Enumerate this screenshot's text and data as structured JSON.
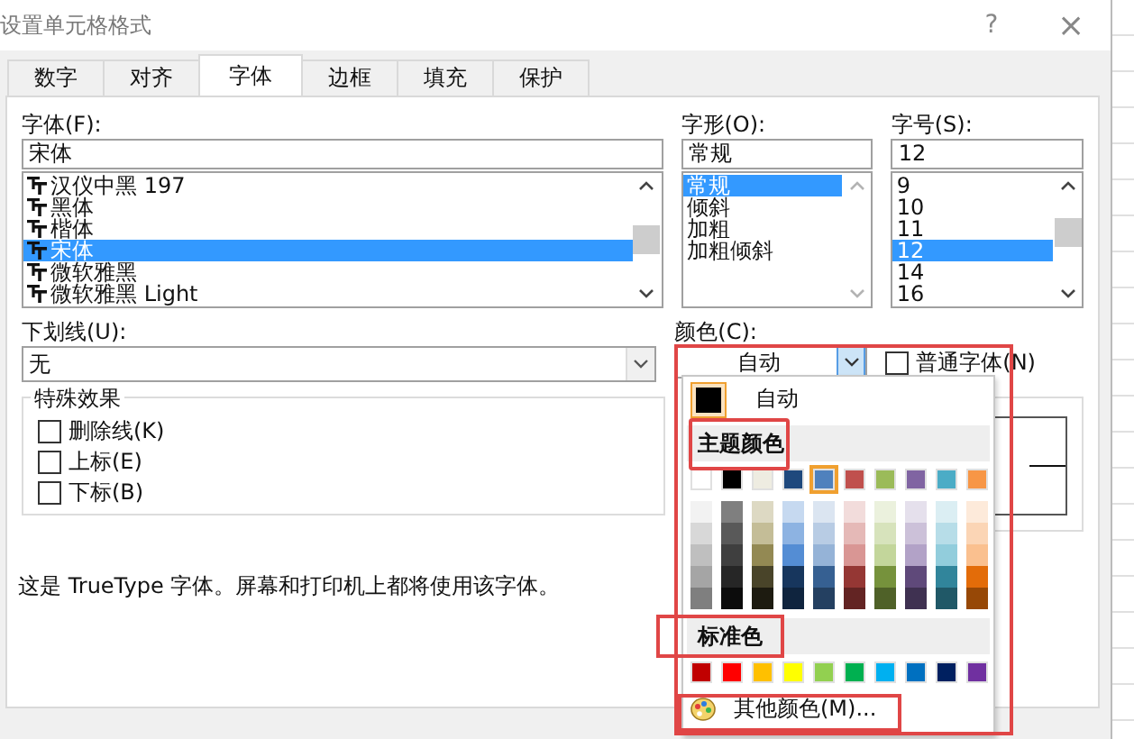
{
  "window": {
    "title": "设置单元格格式",
    "help": "?",
    "close": "×"
  },
  "tabs": [
    {
      "label": "数字",
      "selected": false
    },
    {
      "label": "对齐",
      "selected": false
    },
    {
      "label": "字体",
      "selected": true
    },
    {
      "label": "边框",
      "selected": false
    },
    {
      "label": "填充",
      "selected": false
    },
    {
      "label": "保护",
      "selected": false
    }
  ],
  "font": {
    "label": "字体(F):",
    "value": "宋体",
    "items": [
      {
        "name": "汉仪中黑 197",
        "selected": false
      },
      {
        "name": "黑体",
        "selected": false
      },
      {
        "name": "楷体",
        "selected": false
      },
      {
        "name": "宋体",
        "selected": true
      },
      {
        "name": "微软雅黑",
        "selected": false
      },
      {
        "name": "微软雅黑 Light",
        "selected": false
      }
    ]
  },
  "style": {
    "label": "字形(O):",
    "value": "常规",
    "items": [
      {
        "name": "常规",
        "selected": true
      },
      {
        "name": "倾斜",
        "selected": false
      },
      {
        "name": "加粗",
        "selected": false
      },
      {
        "name": "加粗倾斜",
        "selected": false
      }
    ]
  },
  "size": {
    "label": "字号(S):",
    "value": "12",
    "items": [
      {
        "name": "9",
        "selected": false
      },
      {
        "name": "10",
        "selected": false
      },
      {
        "name": "11",
        "selected": false
      },
      {
        "name": "12",
        "selected": true
      },
      {
        "name": "14",
        "selected": false
      },
      {
        "name": "16",
        "selected": false
      }
    ]
  },
  "underline": {
    "label": "下划线(U):",
    "value": "无"
  },
  "color": {
    "label": "颜色(C):",
    "value": "自动"
  },
  "normal_font": {
    "label": "普通字体(N)",
    "checked": false
  },
  "effects": {
    "title": "特殊效果",
    "items": [
      {
        "label": "删除线(K)",
        "checked": false
      },
      {
        "label": "上标(E)",
        "checked": false
      },
      {
        "label": "下标(B)",
        "checked": false
      }
    ]
  },
  "note": "这是 TrueType 字体。屏幕和打印机上都将使用该字体。",
  "color_menu": {
    "automatic": {
      "label": "自动",
      "color": "#000000"
    },
    "theme_title": "主题颜色",
    "theme": [
      {
        "color": "#ffffff",
        "selected": false
      },
      {
        "color": "#000000",
        "selected": false
      },
      {
        "color": "#eeece1",
        "selected": false
      },
      {
        "color": "#1f497d",
        "selected": false
      },
      {
        "color": "#4f81bd",
        "selected": true
      },
      {
        "color": "#c0504d",
        "selected": false
      },
      {
        "color": "#9bbb59",
        "selected": false
      },
      {
        "color": "#8064a2",
        "selected": false
      },
      {
        "color": "#4bacc6",
        "selected": false
      },
      {
        "color": "#f79646",
        "selected": false
      }
    ],
    "shades": [
      {
        "swatches": [
          {
            "color": "#f2f2f2"
          },
          {
            "color": "#7f7f7f"
          },
          {
            "color": "#ddd9c3"
          },
          {
            "color": "#c6d9f0"
          },
          {
            "color": "#dbe5f1"
          },
          {
            "color": "#f2dcdb"
          },
          {
            "color": "#ebf1dd"
          },
          {
            "color": "#e5e0ec"
          },
          {
            "color": "#dbeef3"
          },
          {
            "color": "#fdeada"
          }
        ]
      },
      {
        "swatches": [
          {
            "color": "#d8d8d8"
          },
          {
            "color": "#595959"
          },
          {
            "color": "#c4bd97"
          },
          {
            "color": "#8db3e2"
          },
          {
            "color": "#b8cce4"
          },
          {
            "color": "#e5b9b7"
          },
          {
            "color": "#d7e3bc"
          },
          {
            "color": "#ccc1d9"
          },
          {
            "color": "#b7dde8"
          },
          {
            "color": "#fbd5b5"
          }
        ]
      },
      {
        "swatches": [
          {
            "color": "#bfbfbf"
          },
          {
            "color": "#3f3f3f"
          },
          {
            "color": "#938953"
          },
          {
            "color": "#548dd4"
          },
          {
            "color": "#95b3d7"
          },
          {
            "color": "#d99694"
          },
          {
            "color": "#c3d69b"
          },
          {
            "color": "#b2a2c7"
          },
          {
            "color": "#92cddc"
          },
          {
            "color": "#fac08f"
          }
        ]
      },
      {
        "swatches": [
          {
            "color": "#a5a5a5"
          },
          {
            "color": "#262626"
          },
          {
            "color": "#494429"
          },
          {
            "color": "#17365d"
          },
          {
            "color": "#366092"
          },
          {
            "color": "#953734"
          },
          {
            "color": "#76923c"
          },
          {
            "color": "#5f497a"
          },
          {
            "color": "#31859b"
          },
          {
            "color": "#e36c09"
          }
        ]
      },
      {
        "swatches": [
          {
            "color": "#7f7f7f"
          },
          {
            "color": "#0c0c0c"
          },
          {
            "color": "#1d1b10"
          },
          {
            "color": "#0f243e"
          },
          {
            "color": "#244061"
          },
          {
            "color": "#632423"
          },
          {
            "color": "#4f6128"
          },
          {
            "color": "#3f3151"
          },
          {
            "color": "#205867"
          },
          {
            "color": "#974806"
          }
        ]
      }
    ],
    "standard_title": "标准色",
    "standard": [
      {
        "color": "#c00000"
      },
      {
        "color": "#ff0000"
      },
      {
        "color": "#ffc000"
      },
      {
        "color": "#ffff00"
      },
      {
        "color": "#92d050"
      },
      {
        "color": "#00b050"
      },
      {
        "color": "#00b0f0"
      },
      {
        "color": "#0070c0"
      },
      {
        "color": "#002060"
      },
      {
        "color": "#7030a0"
      }
    ],
    "more": "其他颜色(M)..."
  }
}
